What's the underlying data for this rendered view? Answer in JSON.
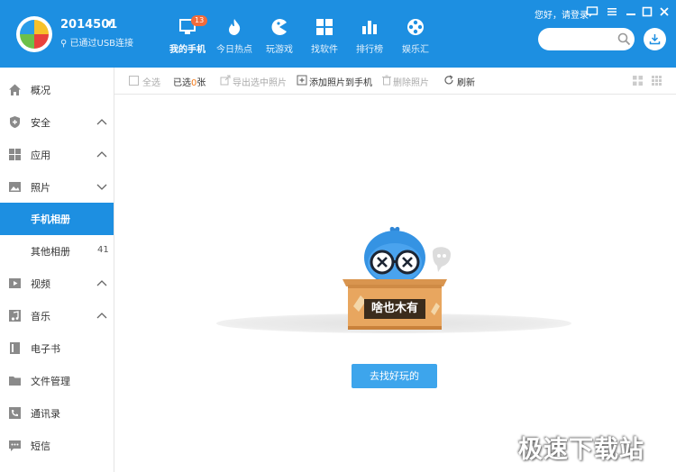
{
  "header": {
    "device_name": "2014501",
    "connection_status": "已通过USB连接",
    "login_text": "您好，请登录",
    "search_placeholder": "",
    "nav": [
      {
        "label": "我的手机",
        "icon": "phone-icon",
        "badge": "13",
        "active": true
      },
      {
        "label": "今日热点",
        "icon": "flame-icon"
      },
      {
        "label": "玩游戏",
        "icon": "game-icon"
      },
      {
        "label": "找软件",
        "icon": "apps-icon"
      },
      {
        "label": "排行榜",
        "icon": "chart-icon"
      },
      {
        "label": "娱乐汇",
        "icon": "film-reel-icon"
      }
    ],
    "window_buttons": [
      "feedback-icon",
      "menu-icon",
      "minimize-icon",
      "maximize-icon",
      "close-icon"
    ]
  },
  "sidebar": {
    "items": [
      {
        "label": "概况",
        "icon": "home-icon"
      },
      {
        "label": "安全",
        "icon": "shield-icon",
        "expandable": true
      },
      {
        "label": "应用",
        "icon": "grid-icon",
        "expandable": true
      },
      {
        "label": "照片",
        "icon": "photo-icon",
        "expandable": true
      },
      {
        "label": "手机相册",
        "active": true
      },
      {
        "label": "其他相册",
        "count": "41"
      },
      {
        "label": "视频",
        "icon": "video-icon",
        "expandable": true
      },
      {
        "label": "音乐",
        "icon": "music-icon",
        "expandable": true
      },
      {
        "label": "电子书",
        "icon": "book-icon"
      },
      {
        "label": "文件管理",
        "icon": "folder-icon"
      },
      {
        "label": "通讯录",
        "icon": "contacts-icon"
      },
      {
        "label": "短信",
        "icon": "message-icon"
      }
    ]
  },
  "toolbar": {
    "select_all": "全选",
    "selected_prefix": "已选",
    "selected_count": "0",
    "selected_suffix": "张",
    "export": "导出选中照片",
    "add": "添加照片到手机",
    "delete": "删除照片",
    "refresh": "刷新"
  },
  "empty_state": {
    "label": "啥也木有",
    "action": "去找好玩的"
  },
  "watermark": "极速下载站",
  "colors": {
    "primary": "#1d8fe1",
    "button": "#3da5ec",
    "accent": "#f27a1a"
  }
}
